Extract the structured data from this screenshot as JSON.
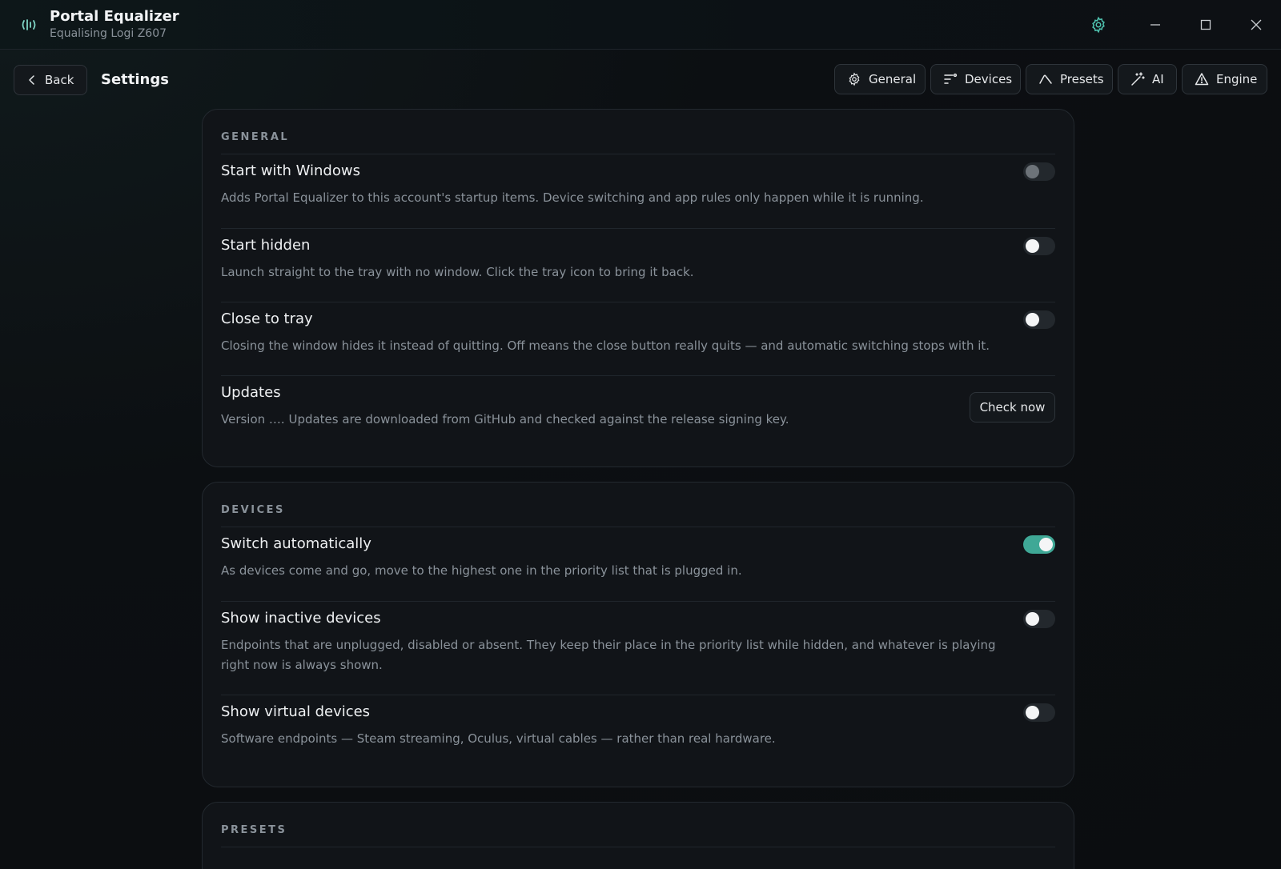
{
  "window": {
    "title": "Portal Equalizer",
    "subtitle": "Equalising Logi Z607",
    "accent_color": "#3fa896"
  },
  "header": {
    "back_label": "Back",
    "page_title": "Settings",
    "nav": [
      {
        "label": "General",
        "icon": "gear-icon"
      },
      {
        "label": "Devices",
        "icon": "sliders-icon"
      },
      {
        "label": "Presets",
        "icon": "curve-icon"
      },
      {
        "label": "AI",
        "icon": "magic-wand-icon"
      },
      {
        "label": "Engine",
        "icon": "warning-icon"
      }
    ]
  },
  "sections": {
    "general": {
      "label": "GENERAL",
      "rows": [
        {
          "title": "Start with Windows",
          "description": "Adds Portal Equalizer to this account's startup items. Device switching and app rules only happen while it is running.",
          "toggle": "off-disabled"
        },
        {
          "title": "Start hidden",
          "description": "Launch straight to the tray with no window. Click the tray icon to bring it back.",
          "toggle": "off"
        },
        {
          "title": "Close to tray",
          "description": "Closing the window hides it instead of quitting. Off means the close button really quits — and automatic switching stops with it.",
          "toggle": "off"
        },
        {
          "title": "Updates",
          "description": "Version …. Updates are downloaded from GitHub and checked against the release signing key.",
          "button_label": "Check now"
        }
      ]
    },
    "devices": {
      "label": "DEVICES",
      "rows": [
        {
          "title": "Switch automatically",
          "description": "As devices come and go, move to the highest one in the priority list that is plugged in.",
          "toggle": "on"
        },
        {
          "title": "Show inactive devices",
          "description": "Endpoints that are unplugged, disabled or absent. They keep their place in the priority list while hidden, and whatever is playing right now is always shown.",
          "toggle": "off"
        },
        {
          "title": "Show virtual devices",
          "description": "Software endpoints — Steam streaming, Oculus, virtual cables — rather than real hardware.",
          "toggle": "off"
        }
      ]
    },
    "presets": {
      "label": "PRESETS"
    }
  }
}
